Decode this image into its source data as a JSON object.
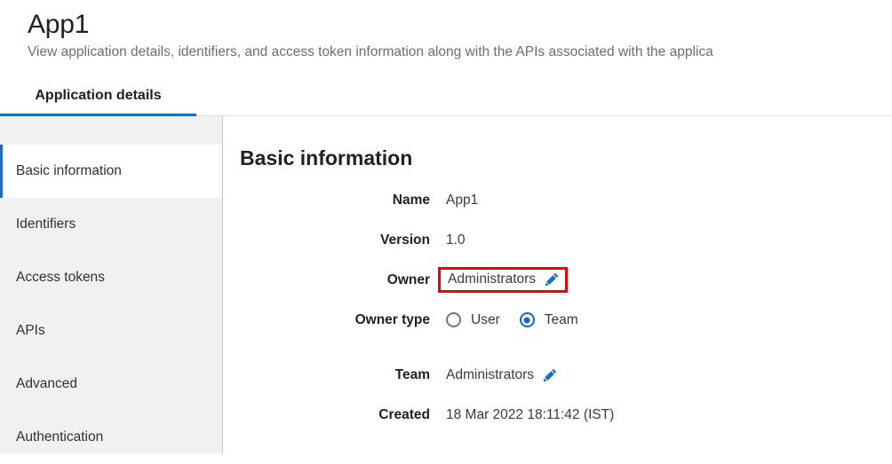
{
  "header": {
    "title": "App1",
    "subtitle": "View application details, identifiers, and access token information along with the APIs associated with the applica"
  },
  "tabs": [
    {
      "label": "Application details",
      "active": true
    }
  ],
  "sidebar": {
    "items": [
      {
        "label": "Basic information",
        "active": true
      },
      {
        "label": "Identifiers",
        "active": false
      },
      {
        "label": "Access tokens",
        "active": false
      },
      {
        "label": "APIs",
        "active": false
      },
      {
        "label": "Advanced",
        "active": false
      },
      {
        "label": "Authentication",
        "active": false
      }
    ]
  },
  "main": {
    "section_title": "Basic information",
    "fields": {
      "name": {
        "label": "Name",
        "value": "App1"
      },
      "version": {
        "label": "Version",
        "value": "1.0"
      },
      "owner": {
        "label": "Owner",
        "value": "Administrators",
        "edit_icon": "pencil-icon",
        "highlighted": true,
        "highlight_color": "#f50000"
      },
      "owner_type": {
        "label": "Owner type",
        "options": [
          {
            "label": "User",
            "selected": false
          },
          {
            "label": "Team",
            "selected": true
          }
        ]
      },
      "team": {
        "label": "Team",
        "value": "Administrators",
        "edit_icon": "pencil-icon"
      },
      "created": {
        "label": "Created",
        "value": "18 Mar 2022 18:11:42 (IST)"
      }
    }
  },
  "colors": {
    "accent": "#1b6ec2",
    "radio_selected": "#1167c4",
    "pencil": "#1b6ec2",
    "highlight": "#f50000",
    "sidebar_bg": "#f1f1f1"
  }
}
